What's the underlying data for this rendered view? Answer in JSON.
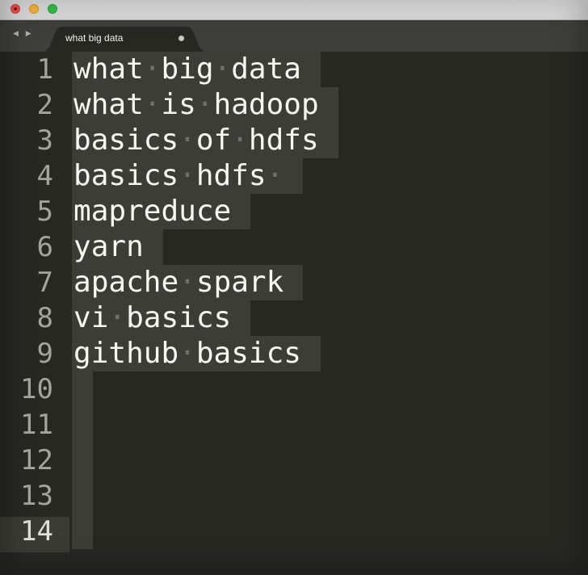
{
  "window": {
    "buttons": {
      "close": "close-button",
      "minimize": "minimize-button",
      "maximize": "maximize-button"
    }
  },
  "tabbar": {
    "nav_arrows": "◀ ▶",
    "tab": {
      "label": "what big data",
      "dirty_indicator": "●"
    }
  },
  "editor": {
    "lines": [
      {
        "number": "1",
        "text": "what big data"
      },
      {
        "number": "2",
        "text": "what is hadoop"
      },
      {
        "number": "3",
        "text": "basics of hdfs"
      },
      {
        "number": "4",
        "text": "basics hdfs "
      },
      {
        "number": "5",
        "text": "mapreduce"
      },
      {
        "number": "6",
        "text": "yarn"
      },
      {
        "number": "7",
        "text": "apache spark"
      },
      {
        "number": "8",
        "text": "vi basics"
      },
      {
        "number": "9",
        "text": "github basics"
      },
      {
        "number": "10",
        "text": ""
      },
      {
        "number": "11",
        "text": ""
      },
      {
        "number": "12",
        "text": ""
      },
      {
        "number": "13",
        "text": ""
      },
      {
        "number": "14",
        "text": ""
      }
    ],
    "current_line": "14"
  },
  "colors": {
    "background": "#272822",
    "text": "#f8f8f2",
    "line_number": "#a4a49a",
    "selection": "#3c3d37",
    "tab_bar": "#3e3f3a"
  }
}
